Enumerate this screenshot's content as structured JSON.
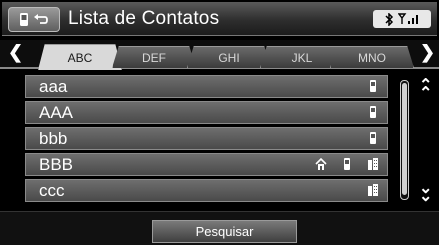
{
  "header": {
    "title": "Lista de Contatos",
    "status_text": "‹B"
  },
  "tabs": [
    {
      "label": "ABC",
      "active": true
    },
    {
      "label": "DEF",
      "active": false
    },
    {
      "label": "GHI",
      "active": false
    },
    {
      "label": "JKL",
      "active": false
    },
    {
      "label": "MNO",
      "active": false
    }
  ],
  "contacts": [
    {
      "name": "aaa",
      "icons": [
        "mobile-icon"
      ]
    },
    {
      "name": "AAA",
      "icons": [
        "mobile-icon"
      ]
    },
    {
      "name": "bbb",
      "icons": [
        "mobile-icon"
      ]
    },
    {
      "name": "BBB",
      "icons": [
        "home-icon",
        "mobile-icon",
        "work-icon"
      ]
    },
    {
      "name": "ccc",
      "icons": [
        "work-icon"
      ]
    }
  ],
  "footer": {
    "search_label": "Pesquisar"
  },
  "colors": {
    "header_bg": "#3a3a3a",
    "row_bg": "#5c5c5c",
    "active_tab": "#d9d9d9"
  }
}
